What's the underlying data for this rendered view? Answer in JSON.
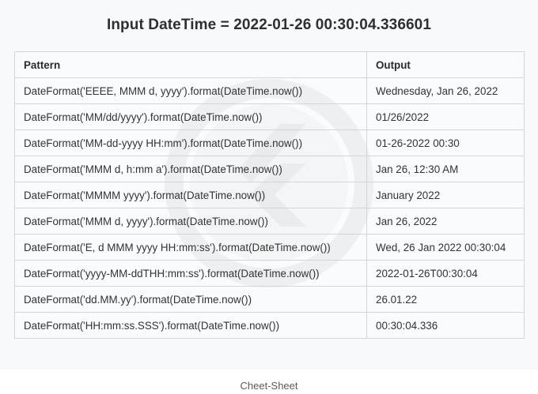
{
  "title": "Input DateTime = 2022-01-26 00:30:04.336601",
  "table": {
    "headers": [
      "Pattern",
      "Output"
    ],
    "rows": [
      {
        "pattern": "DateFormat('EEEE, MMM d, yyyy').format(DateTime.now())",
        "output": "Wednesday, Jan 26, 2022"
      },
      {
        "pattern": "DateFormat('MM/dd/yyyy').format(DateTime.now())",
        "output": "01/26/2022"
      },
      {
        "pattern": "DateFormat('MM-dd-yyyy HH:mm').format(DateTime.now())",
        "output": "01-26-2022 00:30"
      },
      {
        "pattern": "DateFormat('MMM d, h:mm a').format(DateTime.now())",
        "output": "Jan 26, 12:30 AM"
      },
      {
        "pattern": "DateFormat('MMMM yyyy').format(DateTime.now())",
        "output": "January 2022"
      },
      {
        "pattern": "DateFormat('MMM d, yyyy').format(DateTime.now())",
        "output": "Jan 26, 2022"
      },
      {
        "pattern": "DateFormat('E, d MMM yyyy HH:mm:ss').format(DateTime.now())",
        "output": "Wed, 26 Jan 2022 00:30:04"
      },
      {
        "pattern": "DateFormat('yyyy-MM-ddTHH:mm:ss').format(DateTime.now())",
        "output": "2022-01-26T00:30:04"
      },
      {
        "pattern": "DateFormat('dd.MM.yy').format(DateTime.now())",
        "output": "26.01.22"
      },
      {
        "pattern": "DateFormat('HH:mm:ss.SSS').format(DateTime.now())",
        "output": "00:30:04.336"
      }
    ]
  },
  "watermark": {
    "icon": "flutter-logo-watermark-icon",
    "color": "#e6e8ea"
  },
  "caption": "Cheet-Sheet",
  "colors": {
    "background": "#f8f9fa",
    "border": "#cfd6de",
    "text": "#333333"
  }
}
